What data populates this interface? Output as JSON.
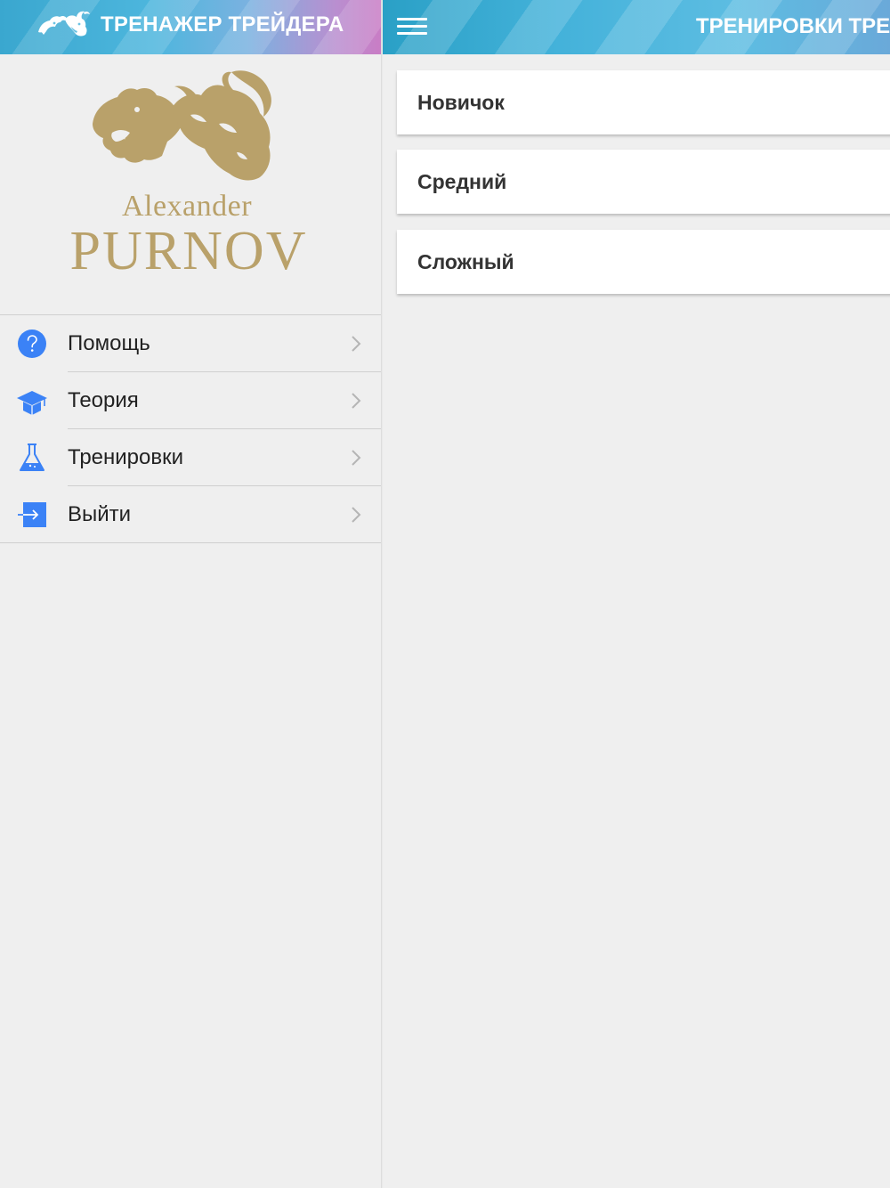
{
  "sidebar": {
    "title": "ТРЕНАЖЕР ТРЕЙДЕРА",
    "logo": {
      "name_top": "Alexander",
      "name_bottom": "PURNOV",
      "color": "#b9a16a"
    },
    "menu": [
      {
        "label": "Помощь",
        "icon": "help-icon"
      },
      {
        "label": "Теория",
        "icon": "graduation-cap-icon"
      },
      {
        "label": "Тренировки",
        "icon": "flask-icon"
      },
      {
        "label": "Выйти",
        "icon": "logout-icon"
      }
    ]
  },
  "main": {
    "title": "ТРЕНИРОВКИ ТРЕЙДЕРА",
    "levels": [
      {
        "label": "Новичок"
      },
      {
        "label": "Средний"
      },
      {
        "label": "Сложный"
      }
    ]
  },
  "colors": {
    "accent": "#3b82f6",
    "header_start": "#3aa7cf",
    "header_end": "#c97dc5",
    "background": "#efefef"
  }
}
